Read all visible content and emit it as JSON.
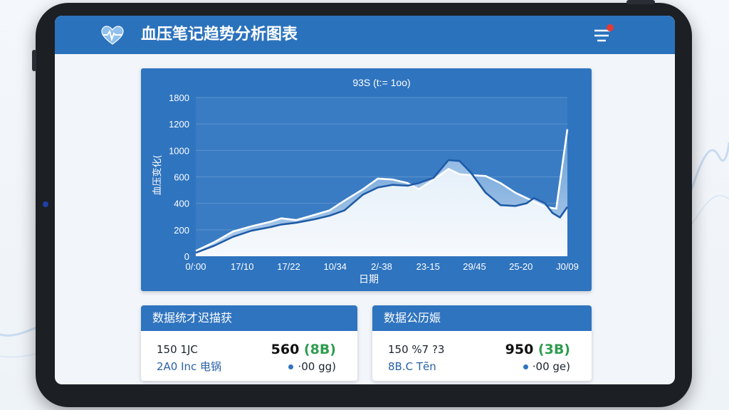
{
  "app": {
    "title": "血压笔记趋势分析图表",
    "icons": {
      "logo": "heart-pulse-icon",
      "menu": "filter-menu-icon",
      "notification": "notification-dot"
    },
    "colors": {
      "header": "#2b72bd",
      "chart_panel": "#2f74bf",
      "accent_green": "#2e9c4e",
      "alert": "#e53935"
    }
  },
  "chart_data": {
    "type": "area",
    "title": "93S (t:= 1oo)",
    "xlabel": "日期",
    "ylabel": "血压变化(",
    "ylim": [
      0,
      1800
    ],
    "yticks": [
      "0",
      "200",
      "400",
      "600",
      "1000",
      "1200",
      "1800"
    ],
    "xtick_labels": [
      "0/:00",
      "17/10",
      "17/22",
      "10/34",
      "2/-38",
      "23-15",
      "29/45",
      "25-20",
      "J0/09"
    ],
    "grid": true,
    "series": [
      {
        "values": [
          [
            0,
            60
          ],
          [
            5,
            160
          ],
          [
            10,
            280
          ],
          [
            15,
            340
          ],
          [
            20,
            390
          ],
          [
            23,
            430
          ],
          [
            27,
            410
          ],
          [
            32,
            470
          ],
          [
            36,
            520
          ],
          [
            40,
            630
          ],
          [
            45,
            760
          ],
          [
            49,
            880
          ],
          [
            53,
            870
          ],
          [
            57,
            830
          ],
          [
            60,
            760
          ],
          [
            64,
            870
          ],
          [
            68,
            990
          ],
          [
            71,
            930
          ],
          [
            74,
            920
          ],
          [
            78,
            910
          ],
          [
            82,
            830
          ],
          [
            86,
            720
          ],
          [
            91,
            620
          ],
          [
            94,
            560
          ],
          [
            97,
            540
          ],
          [
            100,
            1440
          ]
        ]
      },
      {
        "values": [
          [
            0,
            40
          ],
          [
            5,
            120
          ],
          [
            10,
            220
          ],
          [
            15,
            290
          ],
          [
            20,
            330
          ],
          [
            23,
            360
          ],
          [
            27,
            380
          ],
          [
            32,
            420
          ],
          [
            36,
            460
          ],
          [
            40,
            520
          ],
          [
            45,
            700
          ],
          [
            49,
            780
          ],
          [
            53,
            810
          ],
          [
            57,
            800
          ],
          [
            60,
            830
          ],
          [
            64,
            890
          ],
          [
            68,
            1090
          ],
          [
            71,
            1080
          ],
          [
            74,
            950
          ],
          [
            78,
            720
          ],
          [
            82,
            580
          ],
          [
            86,
            570
          ],
          [
            89,
            600
          ],
          [
            91,
            660
          ],
          [
            94,
            600
          ],
          [
            96,
            490
          ],
          [
            98,
            440
          ],
          [
            100,
            560
          ]
        ]
      }
    ]
  },
  "cards": [
    {
      "title": "数据统才迟描获",
      "row1": {
        "label": "150 1JC",
        "value": "560 ",
        "value_paren": "(8B)"
      },
      "row2": {
        "label": "2A0 Inc 电锅",
        "sub": "·00 gg)"
      }
    },
    {
      "title": "数据公历娠",
      "row1": {
        "label": "150 %7 ?3",
        "value": "950 ",
        "value_paren": "(3B)"
      },
      "row2": {
        "label": "8B.C Tẽn",
        "sub": "·00 ge)"
      }
    }
  ]
}
